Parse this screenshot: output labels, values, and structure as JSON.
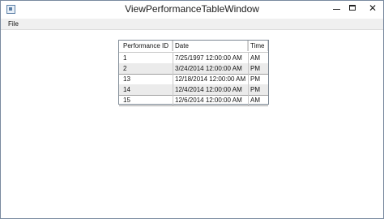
{
  "window": {
    "title": "ViewPerformanceTableWindow"
  },
  "menu": {
    "file_label": "File"
  },
  "table": {
    "columns": [
      "Performance ID",
      "Date",
      "Time"
    ],
    "rows": [
      [
        "1",
        "7/25/1997 12:00:00 AM",
        "AM"
      ],
      [
        "2",
        "3/24/2014 12:00:00 AM",
        "PM"
      ],
      [
        "13",
        "12/18/2014 12:00:00 AM",
        "PM"
      ],
      [
        "14",
        "12/4/2014 12:00:00 AM",
        "PM"
      ],
      [
        "15",
        "12/6/2014 12:00:00 AM",
        "AM"
      ]
    ]
  },
  "icons": {
    "app": "window-app-icon",
    "minimize": "minimize-icon",
    "maximize": "maximize-icon",
    "close": "close-icon"
  }
}
